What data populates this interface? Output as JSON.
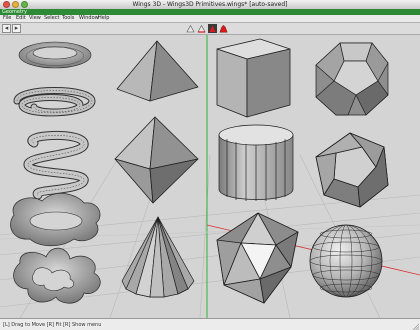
{
  "window": {
    "title": "Wings 3D - Wings3D Primitives.wings* [auto-saved]"
  },
  "geometry_strip": {
    "label": "Geometry"
  },
  "menubar": {
    "items": [
      "File",
      "Edit",
      "View",
      "Select",
      "Tools",
      "Window",
      "Help"
    ]
  },
  "toolbar": {
    "selection_modes": [
      "vertex",
      "edge",
      "face",
      "body"
    ],
    "active_mode": "face",
    "colors": {
      "vertex": "#e8e8e8",
      "edge": "#e8e8e8",
      "face": "#d91a1a",
      "body": "#d91a1a"
    }
  },
  "statusbar": {
    "text": "[L] Drag to Move  [R] Fit  [R] Show menu"
  },
  "scene": {
    "objects": [
      "torus",
      "spiral",
      "spring",
      "lumpy-torus",
      "wavy-torus",
      "pyramid",
      "octahedron",
      "cone",
      "cube",
      "cylinder",
      "icosahedron",
      "dodecahedron-truncated",
      "dodecahedron",
      "uv-sphere"
    ]
  }
}
